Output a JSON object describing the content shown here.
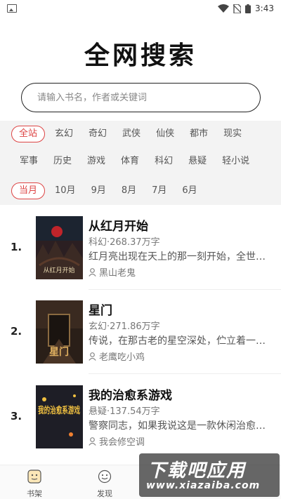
{
  "status_bar": {
    "time": "3:43"
  },
  "page_title": "全网搜索",
  "search": {
    "placeholder": "请输入书名，作者或关键词"
  },
  "filters": {
    "categories_row1": [
      "全站",
      "玄幻",
      "奇幻",
      "武侠",
      "仙侠",
      "都市",
      "现实"
    ],
    "categories_row2": [
      "军事",
      "历史",
      "游戏",
      "体育",
      "科幻",
      "悬疑",
      "轻小说"
    ],
    "months": [
      "当月",
      "10月",
      "9月",
      "8月",
      "7月",
      "6月"
    ],
    "active_category": "全站",
    "active_month": "当月"
  },
  "books": [
    {
      "rank": "1.",
      "title": "从红月开始",
      "meta": "科幻·268.37万字",
      "desc": "红月亮出现在天上的那一刻开始，全世…",
      "author": "黑山老鬼",
      "cover_text": "从红月开始",
      "cover_color": "#3a2a2a"
    },
    {
      "rank": "2.",
      "title": "星门",
      "meta": "玄幻·271.86万字",
      "desc": "传说，在那古老的星空深处，伫立着一…",
      "author": "老鹰吃小鸡",
      "cover_text": "星门",
      "cover_color": "#2a1f18"
    },
    {
      "rank": "3.",
      "title": "我的治愈系游戏",
      "meta": "悬疑·137.54万字",
      "desc": "警察同志，如果我说这是一款休闲治愈…",
      "author": "我会修空调",
      "cover_text": "我的治愈系游戏",
      "cover_color": "#1e1e26"
    }
  ],
  "bottom_nav": [
    {
      "label": "书架",
      "icon": "bookshelf-icon"
    },
    {
      "label": "发现",
      "icon": "discover-icon"
    }
  ],
  "watermark": {
    "line1": "下载吧应用",
    "line2": "www.xiazaiba.com"
  },
  "colors": {
    "accent": "#dd4444",
    "filter_bg": "#f3f3f3"
  }
}
